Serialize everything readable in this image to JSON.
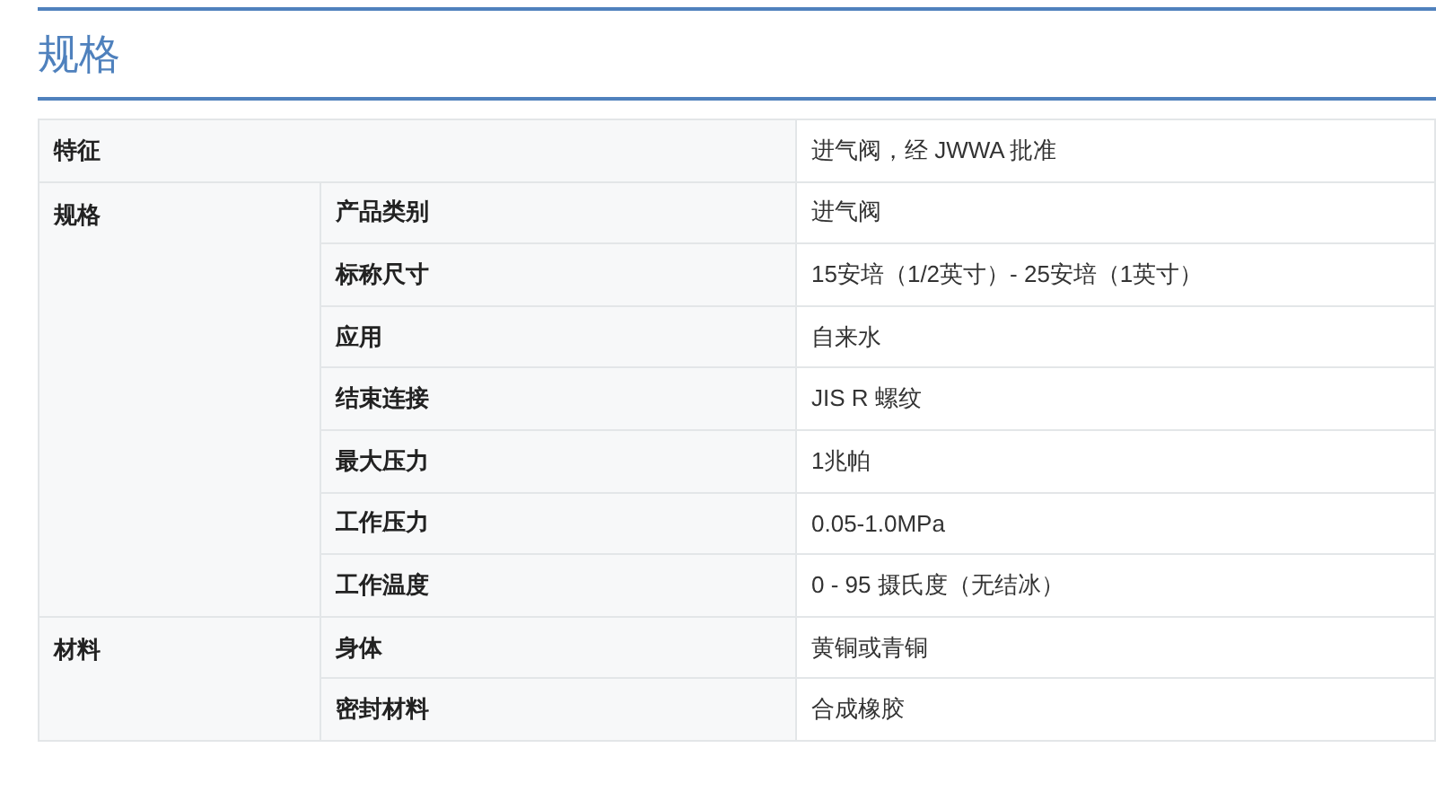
{
  "heading": "规格",
  "sections": [
    {
      "kind": "single",
      "label": "特征",
      "value": "进气阀，经 JWWA 批准"
    },
    {
      "kind": "group",
      "label": "规格",
      "items": [
        {
          "name": "产品类别",
          "value": "进气阀"
        },
        {
          "name": "标称尺寸",
          "value": "15安培（1/2英寸）- 25安培（1英寸）"
        },
        {
          "name": "应用",
          "value": "自来水"
        },
        {
          "name": "结束连接",
          "value": "JIS R 螺纹"
        },
        {
          "name": "最大压力",
          "value": "1兆帕"
        },
        {
          "name": "工作压力",
          "value": "0.05-1.0MPa"
        },
        {
          "name": "工作温度",
          "value": "0 - 95 摄氏度（无结冰）"
        }
      ]
    },
    {
      "kind": "group",
      "label": "材料",
      "items": [
        {
          "name": "身体",
          "value": "黄铜或青铜"
        },
        {
          "name": "密封材料",
          "value": "合成橡胶"
        }
      ]
    }
  ]
}
